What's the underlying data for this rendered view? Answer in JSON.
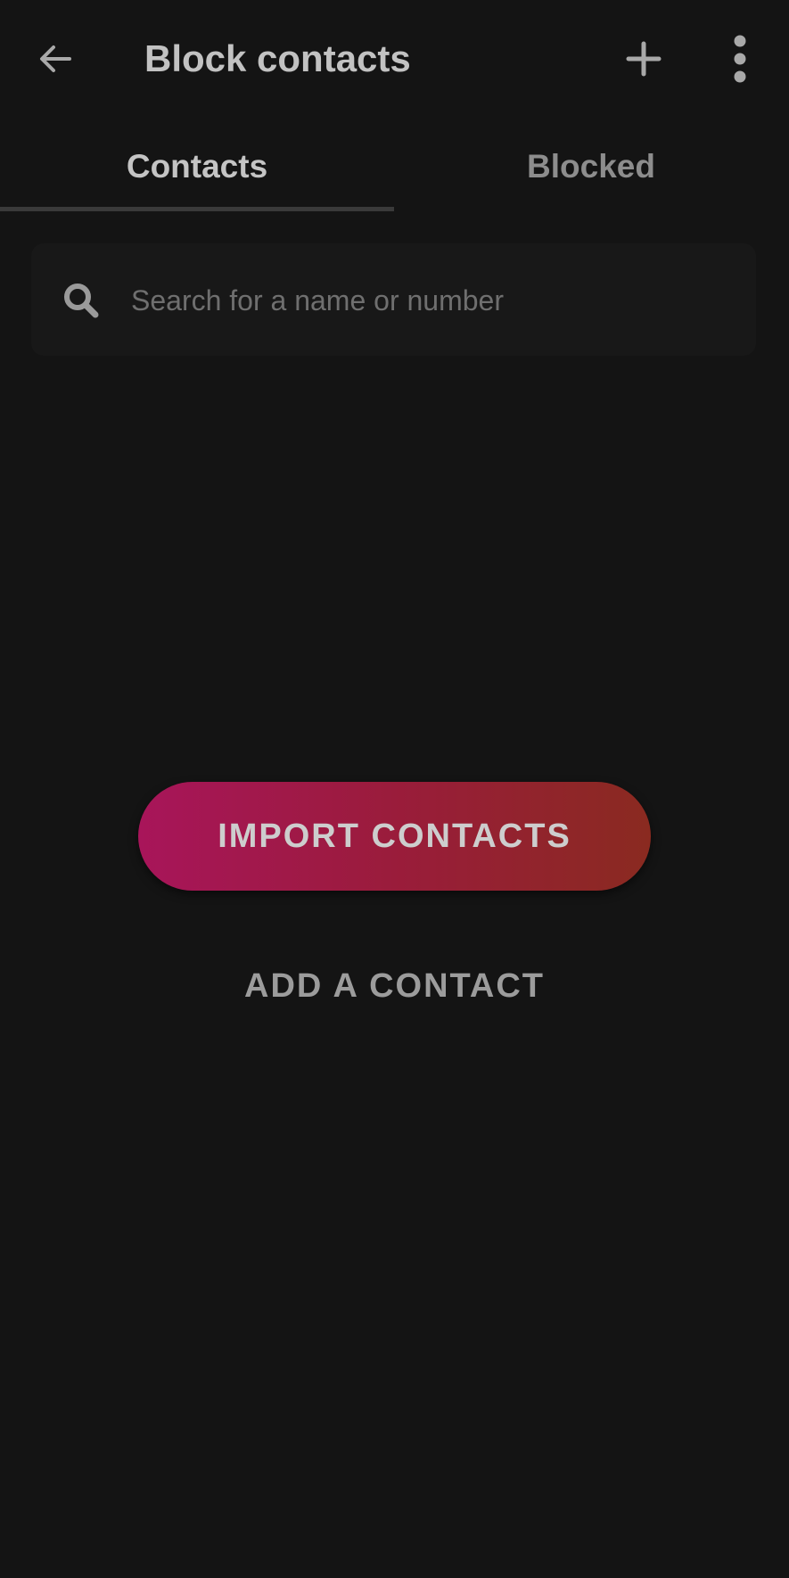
{
  "header": {
    "title": "Block contacts",
    "back_icon": "arrow-left-icon",
    "add_icon": "plus-icon",
    "more_icon": "more-vertical-icon"
  },
  "tabs": [
    {
      "label": "Contacts",
      "selected": true
    },
    {
      "label": "Blocked",
      "selected": false
    }
  ],
  "search": {
    "placeholder": "Search for a name or number",
    "value": "",
    "icon": "search-icon"
  },
  "actions": {
    "import_label": "IMPORT CONTACTS",
    "add_label": "ADD A CONTACT"
  },
  "colors": {
    "background": "#141414",
    "gradient_start": "#a8155a",
    "gradient_end": "#8a2a20"
  }
}
